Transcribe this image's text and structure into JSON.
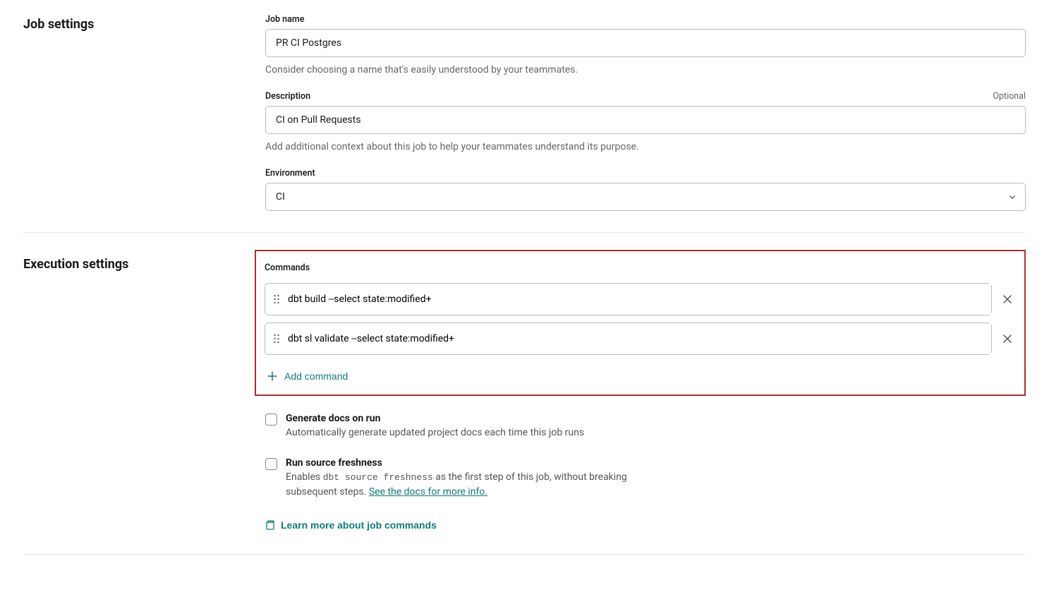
{
  "jobSettings": {
    "title": "Job settings",
    "jobName": {
      "label": "Job name",
      "value": "PR CI Postgres",
      "help": "Consider choosing a name that's easily understood by your teammates."
    },
    "description": {
      "label": "Description",
      "optional": "Optional",
      "value": "CI on Pull Requests",
      "help": "Add additional context about this job to help your teammates understand its purpose."
    },
    "environment": {
      "label": "Environment",
      "value": "CI"
    }
  },
  "executionSettings": {
    "title": "Execution settings",
    "commandsLabel": "Commands",
    "commands": [
      "dbt build --select state:modified+",
      "dbt sl validate --select state:modified+"
    ],
    "addCommand": "Add command",
    "generateDocs": {
      "title": "Generate docs on run",
      "desc": "Automatically generate updated project docs each time this job runs"
    },
    "sourceFreshness": {
      "title": "Run source freshness",
      "descPrefix": "Enables ",
      "code": "dbt source freshness",
      "descSuffix": " as the first step of this job, without breaking subsequent steps. ",
      "link": "See the docs for more info."
    },
    "learnMore": "Learn more about job commands"
  }
}
